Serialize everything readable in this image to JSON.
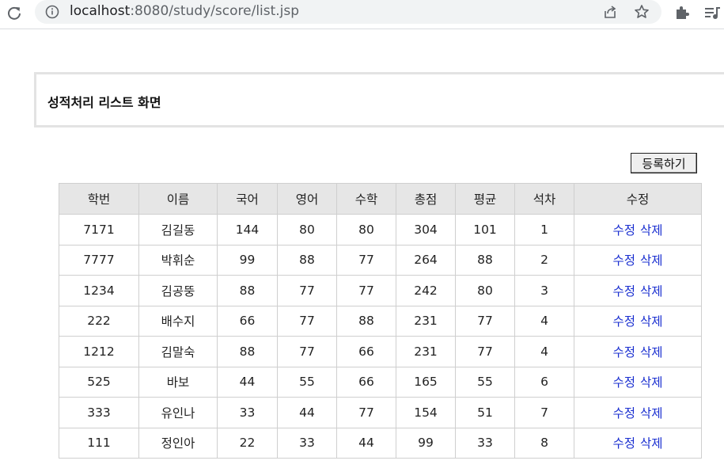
{
  "browser": {
    "url_host": "localhost",
    "url_path": ":8080/study/score/list.jsp",
    "icons": {
      "reload": "reload-icon",
      "info": "info-icon",
      "share": "share-icon",
      "bookmark": "star-icon",
      "extensions": "puzzle-icon",
      "media": "media-queue-icon"
    }
  },
  "page": {
    "title": "성적처리 리스트 화면",
    "register_button": "등록하기"
  },
  "table": {
    "headers": [
      "학번",
      "이름",
      "국어",
      "영어",
      "수학",
      "총점",
      "평균",
      "석차",
      "수정"
    ],
    "edit_label": "수정",
    "delete_label": "삭제",
    "rows": [
      {
        "id": "7171",
        "name": "김길동",
        "kor": "144",
        "eng": "80",
        "math": "80",
        "total": "304",
        "avg": "101",
        "rank": "1"
      },
      {
        "id": "7777",
        "name": "박휘순",
        "kor": "99",
        "eng": "88",
        "math": "77",
        "total": "264",
        "avg": "88",
        "rank": "2"
      },
      {
        "id": "1234",
        "name": "김공뚱",
        "kor": "88",
        "eng": "77",
        "math": "77",
        "total": "242",
        "avg": "80",
        "rank": "3"
      },
      {
        "id": "222",
        "name": "배수지",
        "kor": "66",
        "eng": "77",
        "math": "88",
        "total": "231",
        "avg": "77",
        "rank": "4"
      },
      {
        "id": "1212",
        "name": "김말숙",
        "kor": "88",
        "eng": "77",
        "math": "66",
        "total": "231",
        "avg": "77",
        "rank": "4"
      },
      {
        "id": "525",
        "name": "바보",
        "kor": "44",
        "eng": "55",
        "math": "66",
        "total": "165",
        "avg": "55",
        "rank": "6"
      },
      {
        "id": "333",
        "name": "유인나",
        "kor": "33",
        "eng": "44",
        "math": "77",
        "total": "154",
        "avg": "51",
        "rank": "7"
      },
      {
        "id": "111",
        "name": "정인아",
        "kor": "22",
        "eng": "33",
        "math": "44",
        "total": "99",
        "avg": "33",
        "rank": "8"
      }
    ]
  },
  "colors": {
    "link": "#1a2fd0",
    "header_bg": "#e6e6e6",
    "border": "#cfcfcf"
  }
}
